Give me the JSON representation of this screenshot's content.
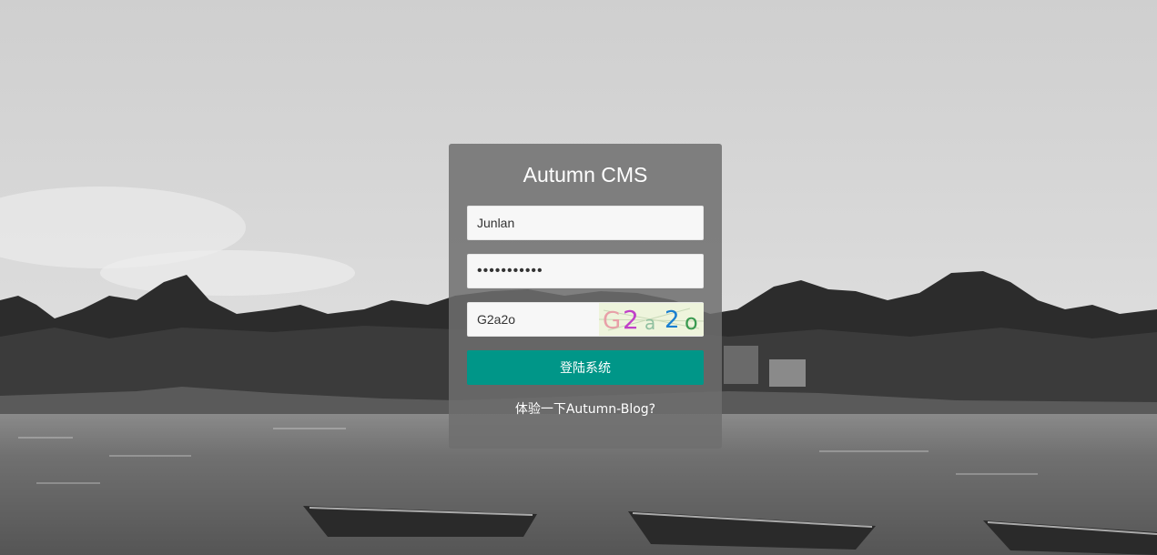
{
  "app": {
    "title": "Autumn CMS"
  },
  "login": {
    "username_value": "Junlan",
    "password_value": "•••••••••••",
    "captcha_value": "G2a2o",
    "captcha_image_text": [
      "G",
      "2",
      "a",
      "2",
      "o"
    ],
    "captcha_colors": [
      "#e8a0a8",
      "#c040c8",
      "#90c0a0",
      "#1a7fd0",
      "#3a9a50"
    ],
    "submit_label": "登陆系统",
    "blog_link_label": "体验一下Autumn-Blog?"
  },
  "colors": {
    "primary": "#009688",
    "card_background": "rgba(110,110,110,0.85)",
    "input_background": "#f7f7f7"
  }
}
